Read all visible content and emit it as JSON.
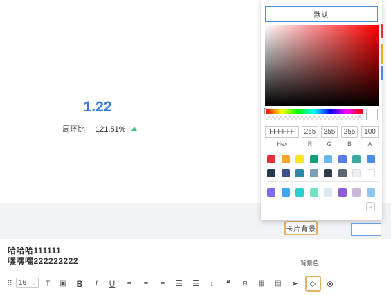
{
  "metric": {
    "value": "1.22",
    "compare_label": "周环比",
    "compare_value": "121.51%"
  },
  "panel": {
    "bg_label": "卡片背景"
  },
  "editor": {
    "line1": "哈哈哈111111",
    "line2": "嘿嘿嘿222222222"
  },
  "tooltip": "背景色",
  "toolbar": {
    "font_size": "16"
  },
  "picker": {
    "default_label": "默认",
    "hex": "FFFFFF",
    "r": "255",
    "g": "255",
    "b": "255",
    "a": "100",
    "hex_label": "Hex",
    "r_label": "R",
    "g_label": "G",
    "b_label": "B",
    "a_label": "A",
    "alpha_min": "0",
    "swatch_row1": [
      "#e5323a",
      "#f5a623",
      "#f8e71c",
      "#0f9d7a",
      "#66b8ee",
      "#5b7be8",
      "#3aaa9b",
      "#4a90e2"
    ],
    "swatch_row2": [
      "#243a4d",
      "#3e4f8c",
      "#2a8aa8",
      "#7aa0b8",
      "#2f3a4a",
      "#5b6670",
      "#eef0f4",
      "#ffffff"
    ],
    "swatch_row3": [
      "#7b6cf0",
      "#3ea6f0",
      "#2ecfcf",
      "#6fe3c4",
      "#dfe7ec",
      "#8b5ed6",
      "#c9b8da",
      "#8ec6f0"
    ]
  },
  "colors": {
    "accent": "#3a7be0",
    "up": "#3cc77a",
    "highlight": "#e6b26a"
  }
}
